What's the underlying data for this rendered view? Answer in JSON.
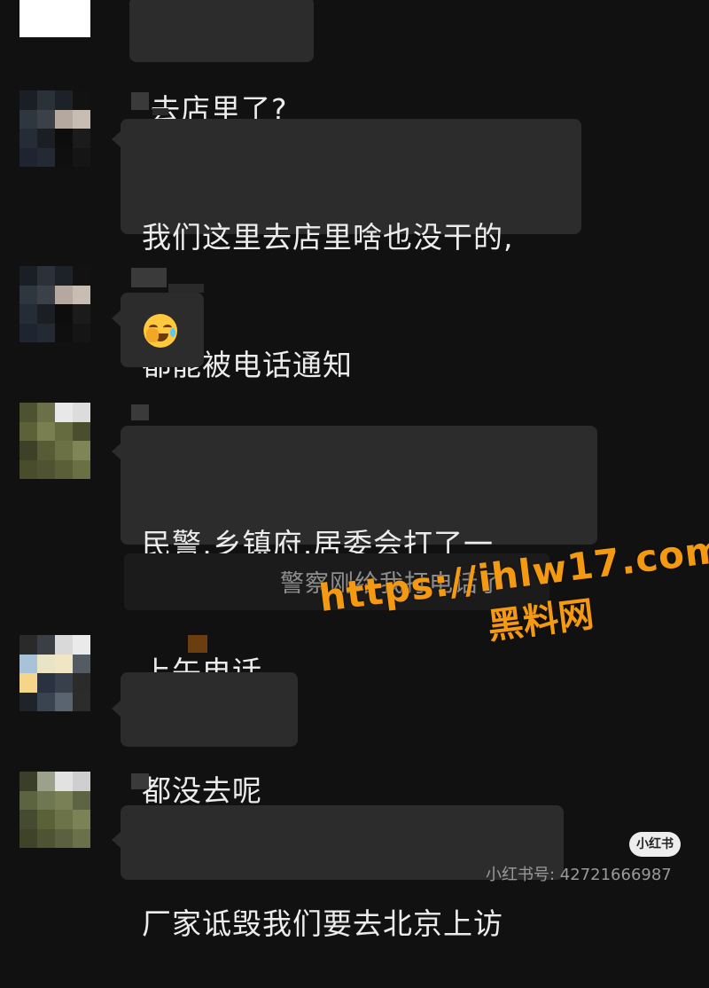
{
  "messages": [
    {
      "text_lines": [
        "去店里了?"
      ]
    },
    {
      "text_lines": [
        "我们这里去店里啥也没干的,",
        "都能被电话通知"
      ]
    },
    {
      "emoji": "loudly-crying-face-icon"
    },
    {
      "text_lines": [
        "民警,乡镇府,居委会打了一",
        "上午电话"
      ]
    },
    {
      "text_lines": [
        "都没去呢"
      ]
    },
    {
      "text_lines": [
        "厂家诋毁我们要去北京上访"
      ]
    }
  ],
  "quoted_message": "警察刚给我打电话了",
  "watermark": {
    "url": "https://ihlw17.com",
    "name": "黑料网"
  },
  "platform": {
    "badge": "小红书",
    "account_id": "小红书号: 42721666987"
  },
  "colors": {
    "background": "#111111",
    "bubble": "#2c2c2c",
    "watermark": "#f39a12"
  }
}
